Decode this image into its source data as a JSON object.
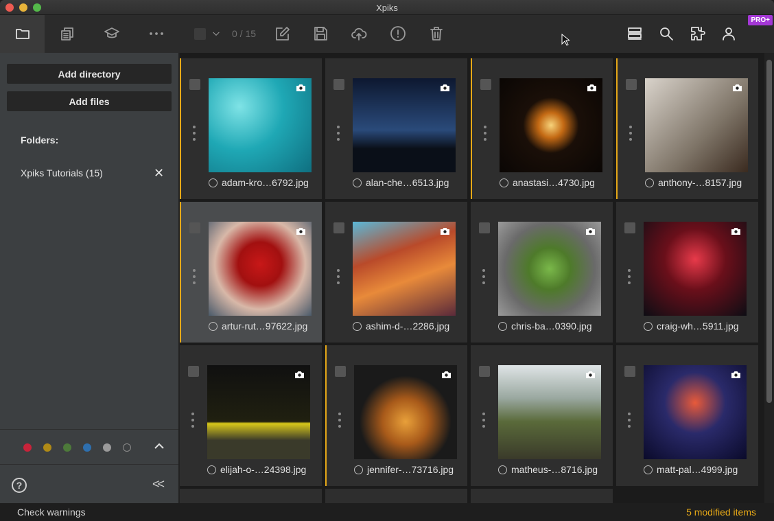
{
  "window": {
    "title": "Xpiks"
  },
  "toolbar": {
    "selection_count": "0 / 15",
    "pro_badge": "PRO+",
    "icons": [
      "folder-icon",
      "files-icon",
      "graduation-cap-icon",
      "more-icon",
      "checkbox-icon",
      "chevron-down-icon",
      "edit-icon",
      "save-icon",
      "upload-cloud-icon",
      "info-icon",
      "trash-icon",
      "list-view-icon",
      "search-icon",
      "plugins-icon",
      "user-icon"
    ]
  },
  "sidebar": {
    "add_directory": "Add directory",
    "add_files": "Add files",
    "folders_label": "Folders:",
    "folders": [
      {
        "label": "Xpiks Tutorials (15)"
      }
    ],
    "color_labels": [
      "#c8233a",
      "#b08a16",
      "#4d7a3a",
      "#2e6fae",
      "#9a9a9a",
      "transparent"
    ]
  },
  "grid": {
    "items": [
      {
        "filename": "adam-kro…6792.jpg",
        "modified": true,
        "selected": false
      },
      {
        "filename": "alan-che…6513.jpg",
        "modified": false,
        "selected": false
      },
      {
        "filename": "anastasi…4730.jpg",
        "modified": true,
        "selected": false
      },
      {
        "filename": "anthony-…8157.jpg",
        "modified": true,
        "selected": false
      },
      {
        "filename": "artur-rut…97622.jpg",
        "modified": true,
        "selected": true
      },
      {
        "filename": "ashim-d-…2286.jpg",
        "modified": false,
        "selected": false
      },
      {
        "filename": "chris-ba…0390.jpg",
        "modified": false,
        "selected": false
      },
      {
        "filename": "craig-wh…5911.jpg",
        "modified": false,
        "selected": false
      },
      {
        "filename": "elijah-o-…24398.jpg",
        "modified": false,
        "selected": false
      },
      {
        "filename": "jennifer-…73716.jpg",
        "modified": true,
        "selected": false
      },
      {
        "filename": "matheus-…8716.jpg",
        "modified": false,
        "selected": false
      },
      {
        "filename": "matt-pal…4999.jpg",
        "modified": false,
        "selected": false
      }
    ]
  },
  "status": {
    "check_warnings": "Check warnings",
    "modified_items": "5 modified items",
    "accent": "#e6a817"
  }
}
